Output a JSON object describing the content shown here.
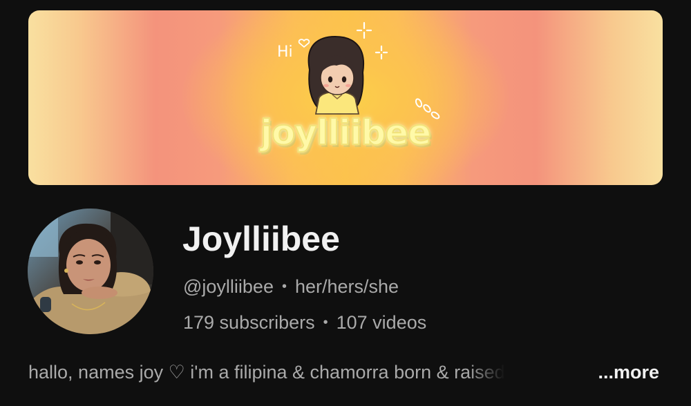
{
  "banner": {
    "title": "joylliibee",
    "greeting": "Hi",
    "heart_icon": "heart-outline-icon",
    "sparkle_icon": "sparkle-icon",
    "colors": {
      "center": "#fcc24c",
      "mid": "#f4937c",
      "edge": "#f9e0a0",
      "title_fill": "#fff9a8"
    }
  },
  "channel": {
    "name": "Joylliibee",
    "handle": "@joylliibee",
    "pronouns": "her/hers/she",
    "separator": "•",
    "subscribers": "179 subscribers",
    "videos": "107 videos"
  },
  "description": {
    "text": "hallo, names joy ♡ i'm a filipina & chamorra born & raised",
    "more_label": "...more"
  },
  "theme": {
    "background": "#0f0f0f",
    "primary_text": "#f1f1f1",
    "secondary_text": "#aaaaaa"
  }
}
